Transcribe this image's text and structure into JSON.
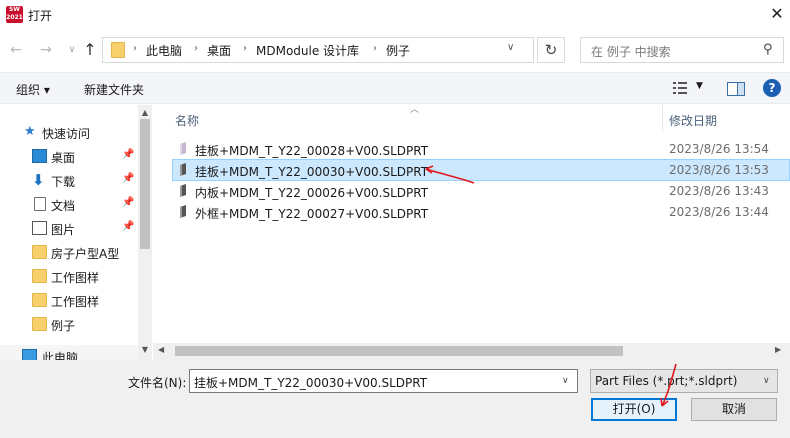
{
  "window": {
    "title": "打开",
    "app_icon_text": "SW 2021"
  },
  "address": {
    "crumbs": [
      "此电脑",
      "桌面",
      "MDModule 设计库",
      "例子"
    ],
    "search_placeholder": "在 例子 中搜索"
  },
  "toolbar": {
    "organize": "组织 ▾",
    "new_folder": "新建文件夹"
  },
  "nav": {
    "quick_access": "快速访问",
    "items": [
      {
        "label": "桌面",
        "icon": "desktop-icon",
        "pinned": true
      },
      {
        "label": "下载",
        "icon": "download-icon",
        "pinned": true
      },
      {
        "label": "文档",
        "icon": "document-icon",
        "pinned": true
      },
      {
        "label": "图片",
        "icon": "picture-icon",
        "pinned": true
      },
      {
        "label": "房子户型A型",
        "icon": "folder-icon",
        "pinned": false
      },
      {
        "label": "工作图样",
        "icon": "folder-icon",
        "pinned": false
      },
      {
        "label": "工作图样",
        "icon": "folder-icon",
        "pinned": false
      },
      {
        "label": "例子",
        "icon": "folder-icon",
        "pinned": false
      },
      {
        "label": "此电脑",
        "icon": "pc-icon",
        "pinned": false
      }
    ]
  },
  "list": {
    "columns": {
      "name": "名称",
      "date": "修改日期"
    },
    "files": [
      {
        "name": "挂板+MDM_T_Y22_00028+V00.SLDPRT",
        "date": "2023/8/26 13:54",
        "selected": false,
        "ghost": true
      },
      {
        "name": "挂板+MDM_T_Y22_00030+V00.SLDPRT",
        "date": "2023/8/26 13:53",
        "selected": true,
        "ghost": false
      },
      {
        "name": "内板+MDM_T_Y22_00026+V00.SLDPRT",
        "date": "2023/8/26 13:43",
        "selected": false,
        "ghost": false
      },
      {
        "name": "外框+MDM_T_Y22_00027+V00.SLDPRT",
        "date": "2023/8/26 13:44",
        "selected": false,
        "ghost": false
      }
    ]
  },
  "bottom": {
    "filename_label": "文件名(N):",
    "filename_value": "挂板+MDM_T_Y22_00030+V00.SLDPRT",
    "filetype_value": "Part Files (*.prt;*.sldprt)",
    "open_label": "打开(O)",
    "cancel_label": "取消"
  },
  "colors": {
    "selection": "#cce8ff",
    "accent": "#0078d7",
    "annotation": "#e0191f"
  }
}
